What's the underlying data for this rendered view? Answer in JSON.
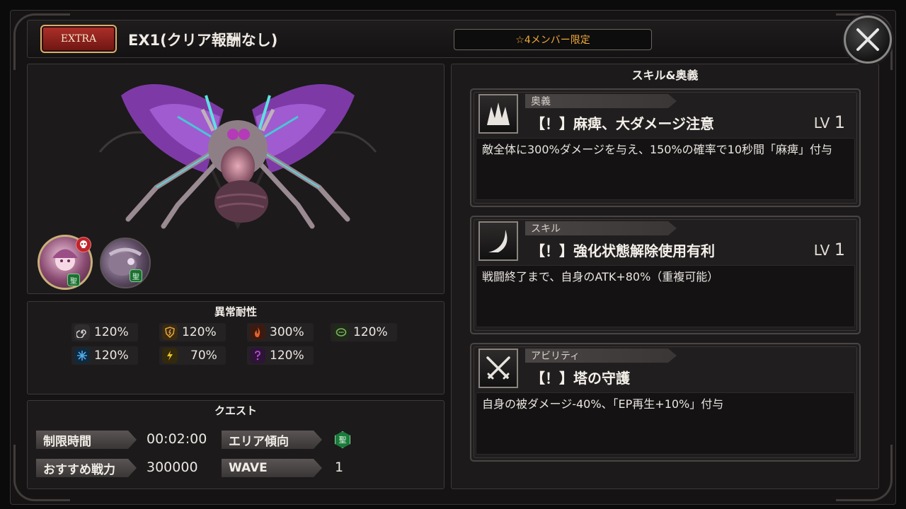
{
  "header": {
    "badge_label": "EXTRA",
    "quest_title": "EX1(クリア報酬なし)",
    "limit_label": "☆4メンバー限定"
  },
  "portraits": [
    {
      "attribute": "聖",
      "danger_icon": "skull-icon"
    },
    {
      "attribute": "聖"
    }
  ],
  "resistance": {
    "title": "異常耐性",
    "items": [
      {
        "icon": "spiral-icon",
        "value": "120%",
        "color": "#cfcfcf"
      },
      {
        "icon": "shield-break-icon",
        "value": "120%",
        "color": "#e0a23a"
      },
      {
        "icon": "burn-icon",
        "value": "300%",
        "color": "#e0642d"
      },
      {
        "icon": "silence-icon",
        "value": "120%",
        "color": "#7ab35f"
      },
      {
        "icon": "freeze-icon",
        "value": "120%",
        "color": "#4fa9e8"
      },
      {
        "icon": "paralysis-icon",
        "value": "70%",
        "color": "#e7c12e"
      },
      {
        "icon": "confusion-icon",
        "value": "120%",
        "color": "#b44ad1"
      }
    ]
  },
  "quest": {
    "title": "クエスト",
    "time_label": "制限時間",
    "time_value": "00:02:00",
    "area_label": "エリア傾向",
    "area_value": "聖",
    "power_label": "おすすめ戦力",
    "power_value": "300000",
    "wave_label": "WAVE",
    "wave_value": "1"
  },
  "skills": {
    "title": "スキル&奥義",
    "cards": [
      {
        "type": "奥義",
        "icon": "spikes-icon",
        "name": "【！】麻痺、大ダメージ注意",
        "lv_label": "LV",
        "lv": "1",
        "description": "敵全体に300%ダメージを与え、150%の確率で10秒間「麻痺」付与"
      },
      {
        "type": "スキル",
        "icon": "crescent-slash-icon",
        "name": "【！】強化状態解除使用有利",
        "lv_label": "LV",
        "lv": "1",
        "description": "戦闘終了まで、自身のATK+80%（重複可能）"
      },
      {
        "type": "アビリティ",
        "icon": "crossed-swords-icon",
        "name": "【！】塔の守護",
        "lv_label": "",
        "lv": "",
        "description": "自身の被ダメージ-40%、「EP再生+10%」付与"
      }
    ]
  }
}
